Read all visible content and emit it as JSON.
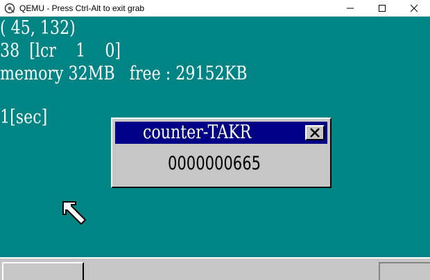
{
  "host_window": {
    "title": "QEMU - Press Ctrl-Alt to exit grab",
    "icon": "qemu-app-icon",
    "controls": [
      "minimize-icon",
      "maximize-icon",
      "close-icon"
    ]
  },
  "guest": {
    "background_color": "#008484",
    "console_lines": [
      "( 45, 132)",
      "38  [lcr    1    0]",
      "memory 32MB   free : 29152KB",
      "1[sec]"
    ],
    "window": {
      "title": "counter-TAKR",
      "value": "0000000665",
      "title_bar_color": "#000084",
      "close_icon": "close-x-icon"
    },
    "cursor_icon": "mouse-pointer-arrow-icon",
    "taskbar_color": "#c6c6c6"
  }
}
